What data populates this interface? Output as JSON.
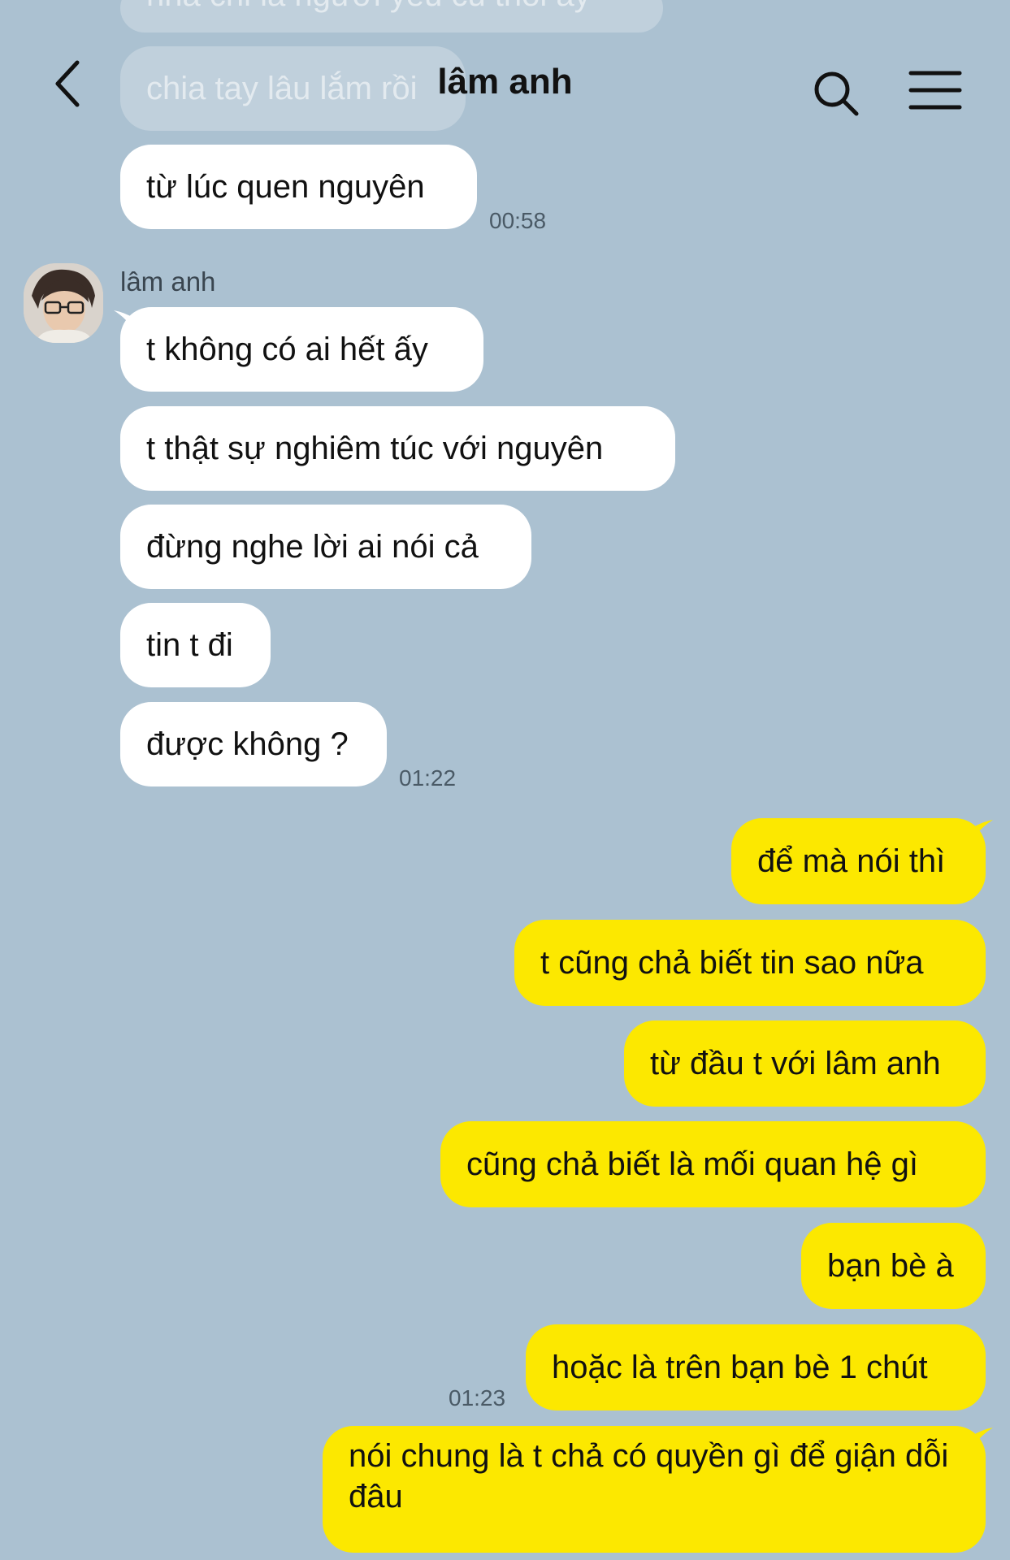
{
  "header": {
    "title": "lâm anh",
    "back_icon": "chevron-left-icon",
    "search_icon": "search-icon",
    "menu_icon": "hamburger-menu-icon"
  },
  "messages_partial": {
    "top_cut": "nhà chi là người yêu cũ thôi ấy",
    "second": "chia tay lâu lắm rồi"
  },
  "thread": {
    "sender_name": "lâm anh",
    "incoming_first": "từ lúc quen nguyên",
    "incoming_first_time": "00:58",
    "incoming": [
      "t không có ai hết ấy",
      "t thật sự nghiêm túc với nguyên",
      "đừng nghe lời ai nói cả",
      "tin t đi",
      "được không ?"
    ],
    "incoming_time": "01:22",
    "outgoing": [
      "để mà nói thì",
      "t cũng chả biết tin sao nữa",
      "từ đầu t với lâm anh",
      "cũng chả biết là mối quan hệ gì",
      "bạn bè à",
      "hoặc là trên bạn bè 1 chút",
      "nói chung là t chả có quyền gì để giận dỗi đâu"
    ],
    "outgoing_time": "01:23"
  },
  "colors": {
    "background": "#abc1d1",
    "incoming_bubble": "#ffffff",
    "outgoing_bubble": "#fce800"
  }
}
